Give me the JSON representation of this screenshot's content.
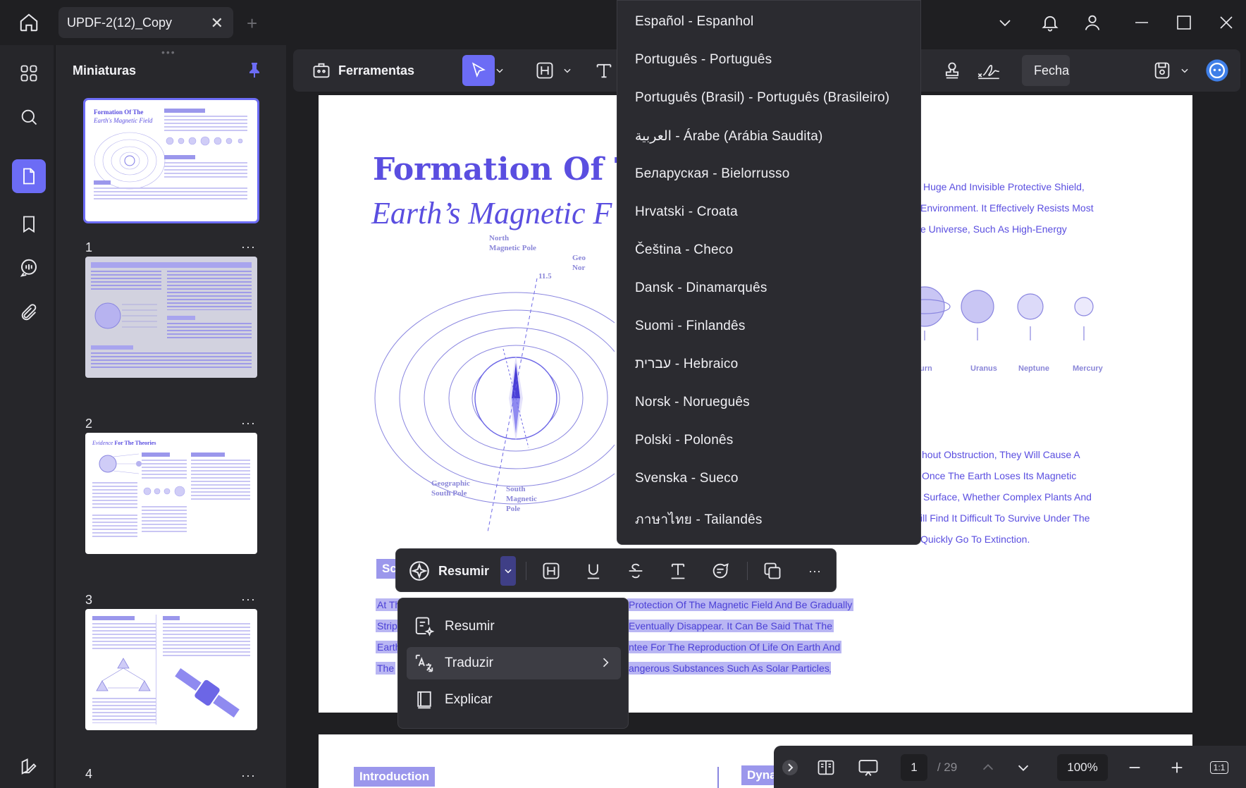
{
  "titlebar": {
    "tab_title": "UPDF-2(12)_Copy",
    "close_glyph": "✕",
    "new_tab_glyph": "+"
  },
  "left_rail": {
    "items": [
      "grid-icon",
      "search-icon",
      "pages-icon",
      "bookmark-icon",
      "comment-icon",
      "attachment-icon",
      "layers-icon"
    ],
    "active": "pages-icon"
  },
  "thumbnails": {
    "title": "Miniaturas",
    "more_glyph": "···",
    "pages": [
      {
        "number": "1",
        "selected": true,
        "heading1": "Formation Of The",
        "heading2": "Earth's Magnetic Field"
      },
      {
        "number": "2",
        "selected": false
      },
      {
        "number": "3",
        "selected": false,
        "heading1": "Evidence",
        "heading2": "For The Theories"
      },
      {
        "number": "4",
        "selected": false
      }
    ]
  },
  "toolbar": {
    "tools_label": "Ferramentas",
    "fechar_label": "Fechar"
  },
  "page": {
    "title_line1": "Formation Of The",
    "title_line2": "Earth’s Magnetic F",
    "right_text": [
      "Huge And Invisible Protective Shield,",
      "Environment. It Effectively Resists Most",
      "e Universe, Such As High-Energy"
    ],
    "planets": [
      "urn",
      "Uranus",
      "Neptune",
      "Mercury"
    ],
    "right_text2": [
      "hout Obstruction, They Will Cause A",
      "Once The Earth Loses Its Magnetic",
      "Surface, Whether Complex Plants And",
      "ill Find It Difficult To Survive Under The",
      "Quickly Go To Extinction."
    ],
    "diagram_labels": {
      "north": "North\nMagnetic Pole",
      "geo_north": "Geo\nNor",
      "angle": "11.5",
      "geo_south": "Geographic\nSouth Pole",
      "south": "South\nMagnetic\nPole"
    },
    "section_chip": "Sc",
    "highlight_left": [
      "At Th",
      "Strip",
      "Earth",
      "The"
    ],
    "highlight_right": [
      "Protection Of The Magnetic Field And Be Gradually",
      "Eventually Disappear. It Can Be Said That The",
      "ntee For The Reproduction Of Life On Earth And",
      "angerous Substances Such As Solar Particles"
    ],
    "highlight_tail": ".",
    "page2_chip_left": "Introduction",
    "page2_chip_right": "Dyna"
  },
  "language_menu": {
    "items": [
      "Español - Espanhol",
      "Português - Português",
      "Português (Brasil) - Português (Brasileiro)",
      "العربية - Árabe (Arábia Saudita)",
      "Беларуская - Bielorrusso",
      "Hrvatski - Croata",
      "Čeština - Checo",
      "Dansk - Dinamarquês",
      "Suomi - Finlandês",
      "עברית - Hebraico",
      "Norsk - Norueguês",
      "Polski - Polonês",
      "Svenska - Sueco",
      "ภาษาไทย - Tailandês"
    ]
  },
  "float_toolbar": {
    "resumir_label": "Resumir",
    "more_glyph": "···"
  },
  "context_menu": {
    "items": [
      {
        "label": "Resumir",
        "icon": "summarize-icon"
      },
      {
        "label": "Traduzir",
        "icon": "translate-icon",
        "has_submenu": true
      },
      {
        "label": "Explicar",
        "icon": "explain-icon"
      }
    ],
    "hovered": "Traduzir"
  },
  "statusbar": {
    "current_page": "1",
    "total_pages": "/ 29",
    "zoom": "100%",
    "fit_label": "1:1"
  },
  "colors": {
    "accent": "#6c6cf5",
    "background": "#1f1f22",
    "panel": "#2b2b30",
    "doc_text": "#5a4ee0",
    "highlight": "#b9b6f3"
  }
}
